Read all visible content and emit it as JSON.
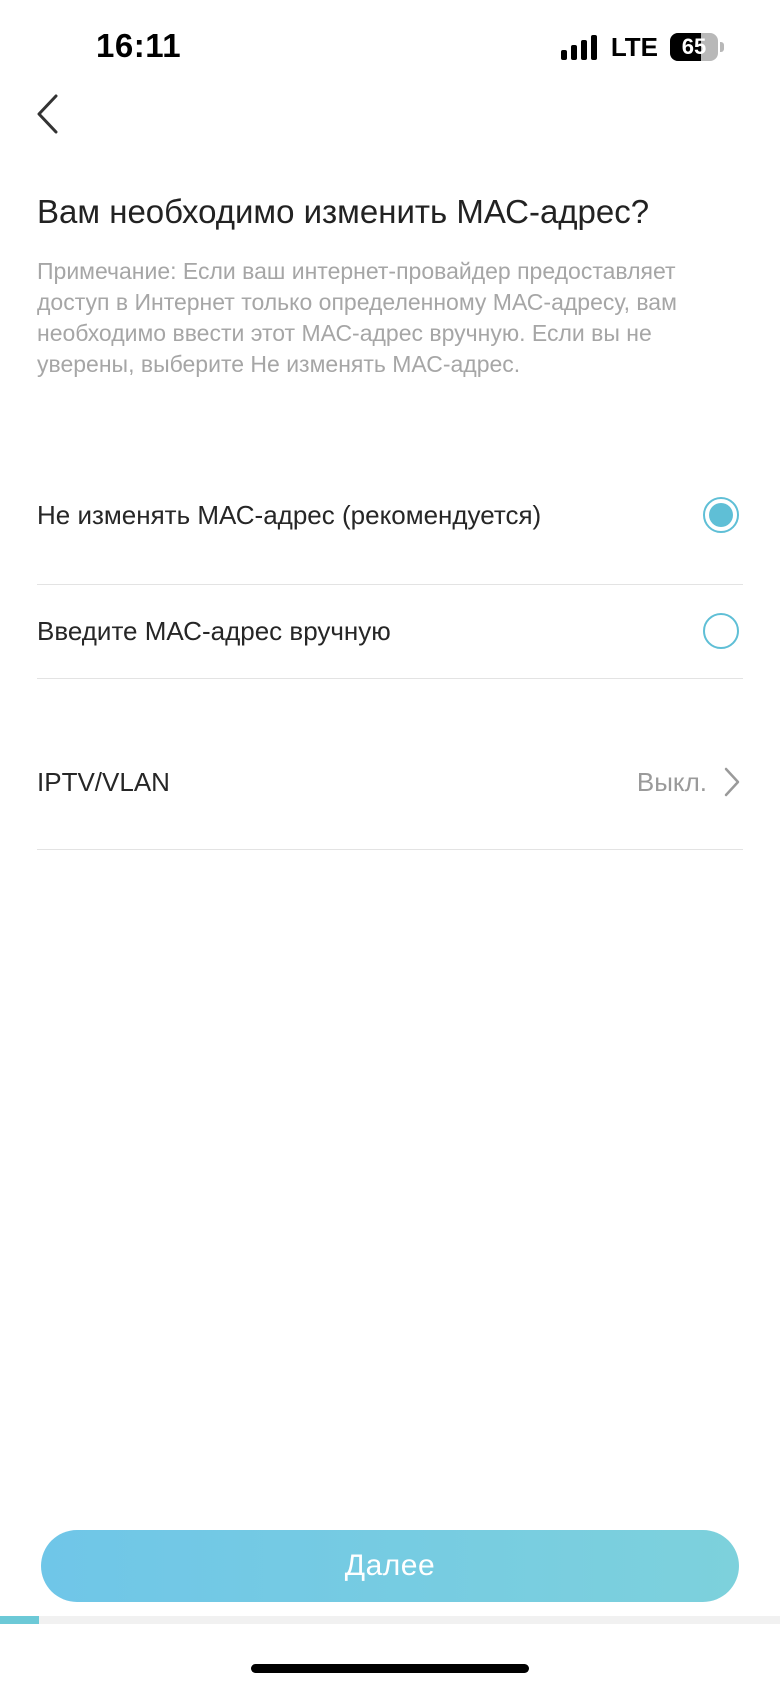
{
  "status_bar": {
    "time": "16:11",
    "network": "LTE",
    "battery_percent": "65",
    "battery_level": 0.65,
    "signal_bars": 4
  },
  "page": {
    "question": "Вам необходимо изменить МАС-адрес?",
    "note": "Примечание: Если ваш интернет-провайдер предоставляет доступ в Интернет только определенному МАС-адресу, вам необходимо ввести этот МАС-адрес вручную. Если вы не уверены, выберите Не изменять МАС-адрес."
  },
  "options": [
    {
      "label": "Не изменять МАС-адрес (рекомендуется)",
      "selected": true
    },
    {
      "label": "Введите МАС-адрес вручную",
      "selected": false
    }
  ],
  "iptv": {
    "label": "IPTV/VLAN",
    "value": "Выкл."
  },
  "next_button": {
    "label": "Далее"
  },
  "progress": {
    "fraction": 0.05
  },
  "colors": {
    "accent": "#5fbfd6",
    "button_start": "#6fc6e8",
    "button_end": "#7dd1dc",
    "note_text": "#a6a6a6"
  }
}
